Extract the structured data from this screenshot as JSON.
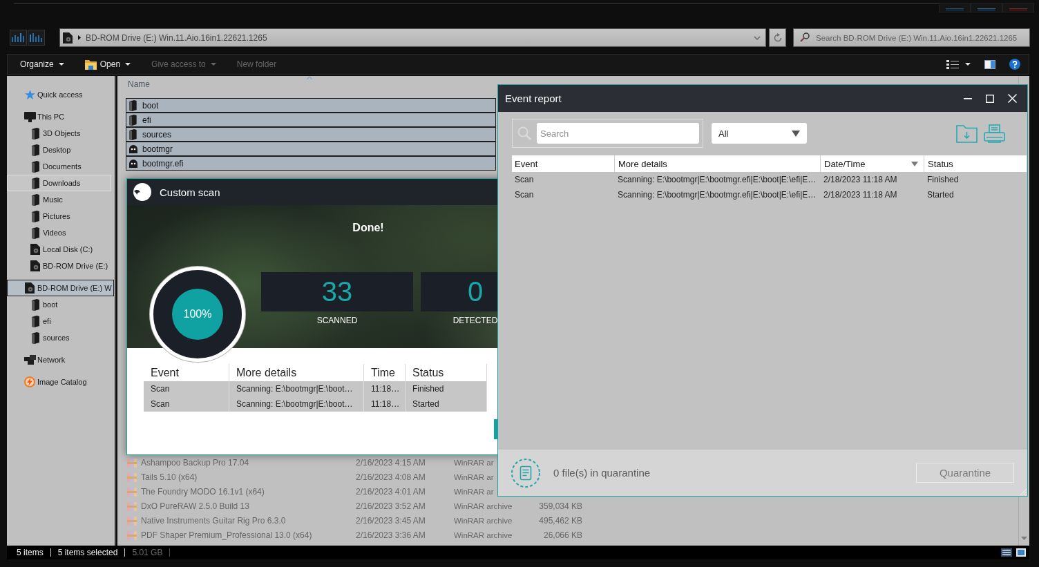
{
  "explorer": {
    "address_bar": {
      "path": "BD-ROM Drive (E:) Win.11.Aio.16in1.22621.1265"
    },
    "search": {
      "placeholder": "Search BD-ROM Drive (E:) Win.11.Aio.16in1.22621.1265"
    },
    "toolbar": [
      {
        "label": "Organize",
        "kind": "text",
        "menu": true,
        "disabled": false
      },
      {
        "label": "Open",
        "kind": "icon",
        "menu": true,
        "disabled": false
      },
      {
        "label": "Give access to",
        "kind": "text",
        "menu": true,
        "disabled": true
      },
      {
        "label": "New folder",
        "kind": "text",
        "menu": false,
        "disabled": true
      }
    ],
    "sidebar": {
      "items": [
        {
          "label": "Quick access",
          "kind": "star",
          "selected": false,
          "hovered": false
        },
        {
          "label": "This PC",
          "kind": "computer",
          "selected": false,
          "hovered": false,
          "children": [
            {
              "label": "3D Objects",
              "kind": "folder",
              "selected": false,
              "hovered": false
            },
            {
              "label": "Desktop",
              "kind": "folder",
              "selected": false,
              "hovered": false
            },
            {
              "label": "Documents",
              "kind": "folder",
              "selected": false,
              "hovered": false
            },
            {
              "label": "Downloads",
              "kind": "folder",
              "selected": false,
              "hovered": true
            },
            {
              "label": "Music",
              "kind": "folder",
              "selected": false,
              "hovered": false
            },
            {
              "label": "Pictures",
              "kind": "folder",
              "selected": false,
              "hovered": false
            },
            {
              "label": "Videos",
              "kind": "folder",
              "selected": false,
              "hovered": false
            },
            {
              "label": "Local Disk (C:)",
              "kind": "drive",
              "selected": false,
              "hovered": false
            },
            {
              "label": "BD-ROM Drive (E:)",
              "kind": "drive",
              "selected": false,
              "hovered": false
            }
          ]
        },
        {
          "label": "BD-ROM Drive (E:) W",
          "kind": "drive",
          "selected": true,
          "hovered": false,
          "children": [
            {
              "label": "boot",
              "kind": "folder",
              "selected": false,
              "hovered": false
            },
            {
              "label": "efi",
              "kind": "folder",
              "selected": false,
              "hovered": false
            },
            {
              "label": "sources",
              "kind": "folder",
              "selected": false,
              "hovered": false
            }
          ]
        },
        {
          "label": "Network",
          "kind": "network",
          "selected": false,
          "hovered": false
        },
        {
          "label": "Image Catalog",
          "kind": "catalog",
          "selected": false,
          "hovered": false
        }
      ]
    },
    "file_list": {
      "columns": [
        {
          "label": "Name",
          "sorted": true
        }
      ],
      "items": [
        {
          "name": "boot",
          "kind": "folder",
          "selected": true
        },
        {
          "name": "efi",
          "kind": "folder",
          "selected": true
        },
        {
          "name": "sources",
          "kind": "folder",
          "selected": true
        },
        {
          "name": "bootmgr",
          "kind": "file",
          "selected": true
        },
        {
          "name": "bootmgr.efi",
          "kind": "file",
          "selected": true
        }
      ],
      "background_rows": [
        {
          "name": "Ashampoo Backup Pro 17.04",
          "date": "2/16/2023 4:15 AM",
          "type": "WinRAR ar"
        },
        {
          "name": "Tails 5.10 (x64)",
          "date": "2/16/2023 4:08 AM",
          "type": "WinRAR ar"
        },
        {
          "name": "The Foundry MODO 16.1v1 (x64)",
          "date": "2/16/2023 4:01 AM",
          "type": "WinRAR ar"
        },
        {
          "name": "DxO PureRAW 2.5.0 Build 13",
          "date": "2/16/2023 3:52 AM",
          "type": "WinRAR archive",
          "size": "359,034 KB"
        },
        {
          "name": "Native Instruments Guitar Rig Pro 6.3.0",
          "date": "2/16/2023 3:45 AM",
          "type": "WinRAR archive",
          "size": "495,462 KB"
        },
        {
          "name": "PDF Shaper Premium_Professional 13.0 (x64)",
          "date": "2/16/2023 3:36 AM",
          "type": "WinRAR archive",
          "size": "26,066 KB"
        }
      ]
    },
    "status_bar": {
      "item_count": "5 items",
      "selection": "5 items selected",
      "size": "5.01 GB"
    }
  },
  "custom_scan": {
    "title": "Custom scan",
    "message": "Done!",
    "progress": {
      "label": "100%",
      "level": 1
    },
    "stats": [
      {
        "value": "33",
        "label": "SCANNED"
      },
      {
        "value": "0",
        "label": "DETECTED"
      }
    ],
    "table": {
      "columns": [
        "Event",
        "More details",
        "Time",
        "Status"
      ],
      "rows": [
        [
          "Scan",
          "Scanning: E:\\bootmgr|E:\\boot…",
          "11:18…",
          "Finished"
        ],
        [
          "Scan",
          "Scanning: E:\\bootmgr|E:\\boot…",
          "11:18…",
          "Started"
        ]
      ]
    }
  },
  "event_report": {
    "title": "Event report",
    "search": {
      "placeholder": "Search"
    },
    "filter": {
      "value": "All"
    },
    "table": {
      "columns": [
        {
          "label": "Event",
          "sorted": false
        },
        {
          "label": "More details",
          "sorted": false
        },
        {
          "label": "Date/Time",
          "sorted": true
        },
        {
          "label": "Status",
          "sorted": false
        }
      ],
      "rows": [
        [
          "Scan",
          "Scanning: E:\\bootmgr|E:\\bootmgr.efi|E:\\boot|E:\\efi|E…",
          "2/18/2023 11:18 AM",
          "Finished"
        ],
        [
          "Scan",
          "Scanning: E:\\bootmgr|E:\\bootmgr.efi|E:\\boot|E:\\efi|E…",
          "2/18/2023 11:18 AM",
          "Started"
        ]
      ]
    },
    "quarantine": {
      "text": "0 file(s) in quarantine",
      "button": {
        "label": "Quarantine",
        "disabled": true
      }
    }
  }
}
